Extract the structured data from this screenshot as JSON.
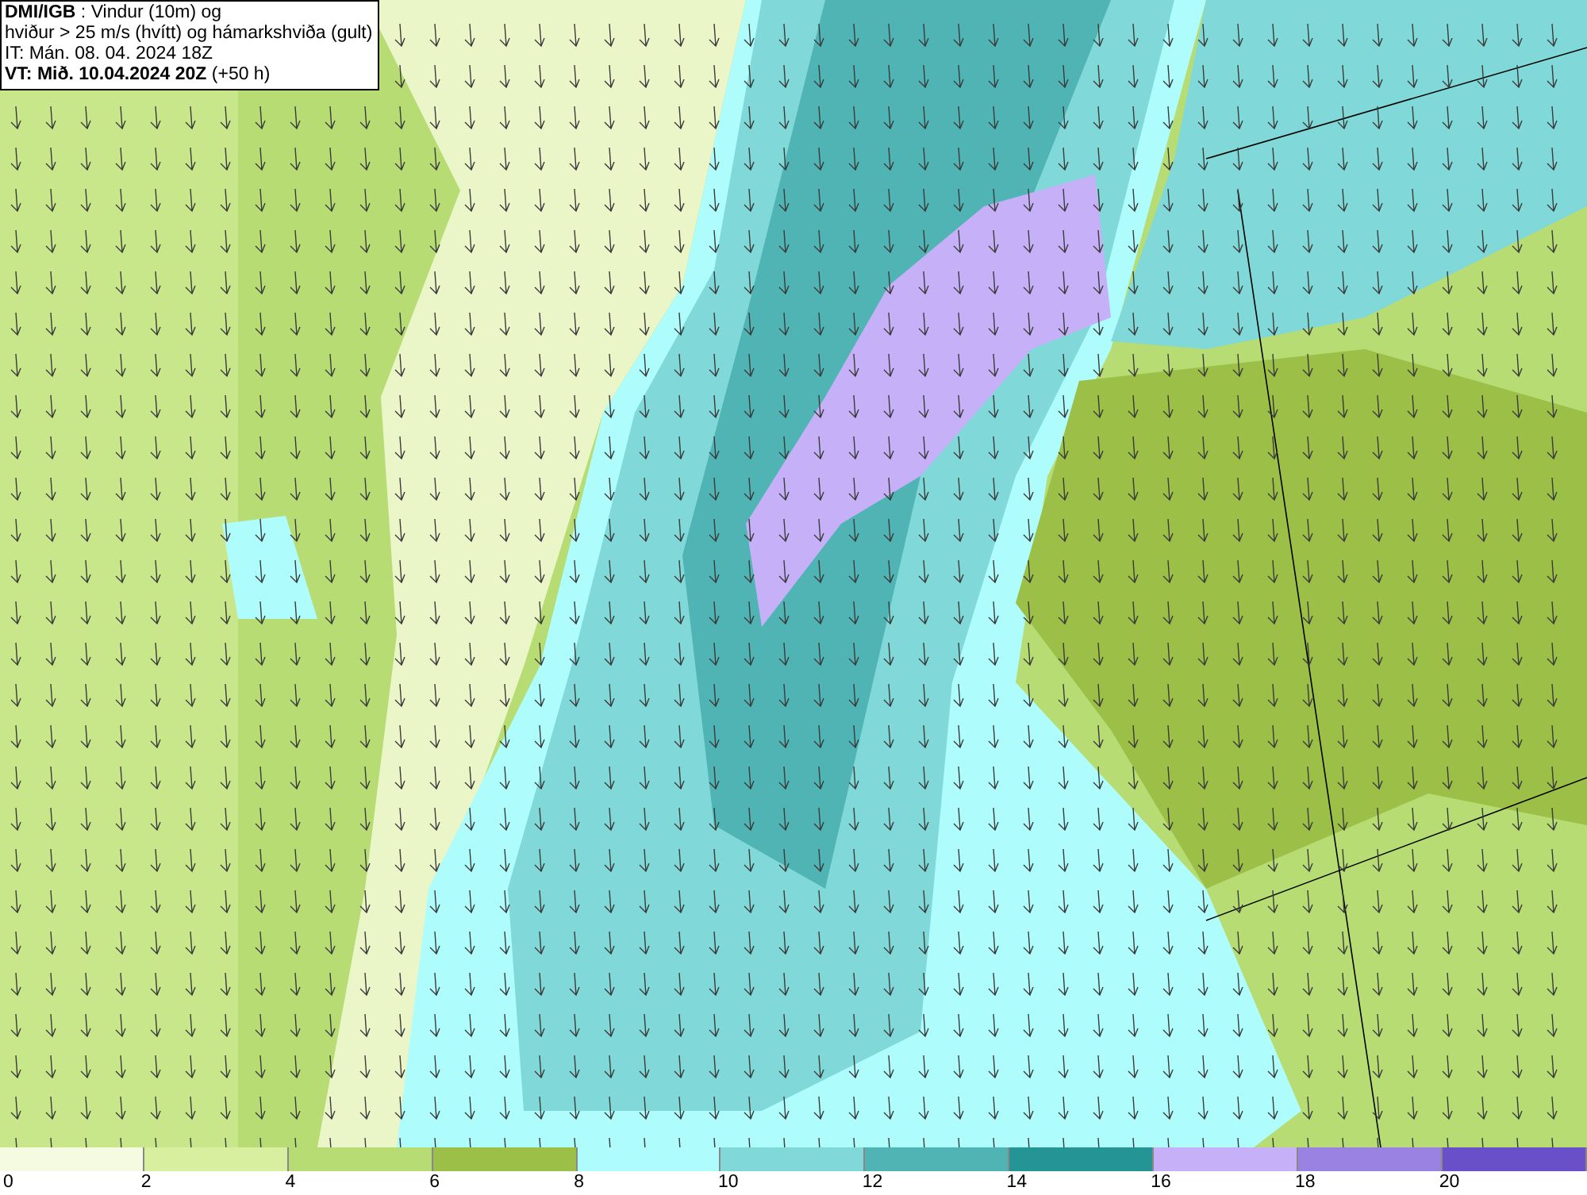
{
  "title_box": {
    "lines": [
      "**DMI/IGB** : Vindur (10m) og",
      "hviður > 25 m/s (hvítt) og hámarkshviða (gult)",
      "IT: Mán. 08. 04. 2024 18Z",
      "**VT: Mið. 10.04.2024 20Z** (+50 h)"
    ]
  },
  "legend": [
    {
      "label": "0",
      "color": "#f5fbe0"
    },
    {
      "label": "2",
      "color": "#d7ef9f"
    },
    {
      "label": "4",
      "color": "#b6dc73"
    },
    {
      "label": "6",
      "color": "#9bbf47"
    },
    {
      "label": "8",
      "color": "#aefcfc"
    },
    {
      "label": "10",
      "color": "#80d8d8"
    },
    {
      "label": "12",
      "color": "#50b4b4"
    },
    {
      "label": "14",
      "color": "#249494"
    },
    {
      "label": "16",
      "color": "#c6b0f8"
    },
    {
      "label": "18",
      "color": "#9a82e2"
    },
    {
      "label": "20",
      "color": "#6a50c8"
    }
  ]
}
